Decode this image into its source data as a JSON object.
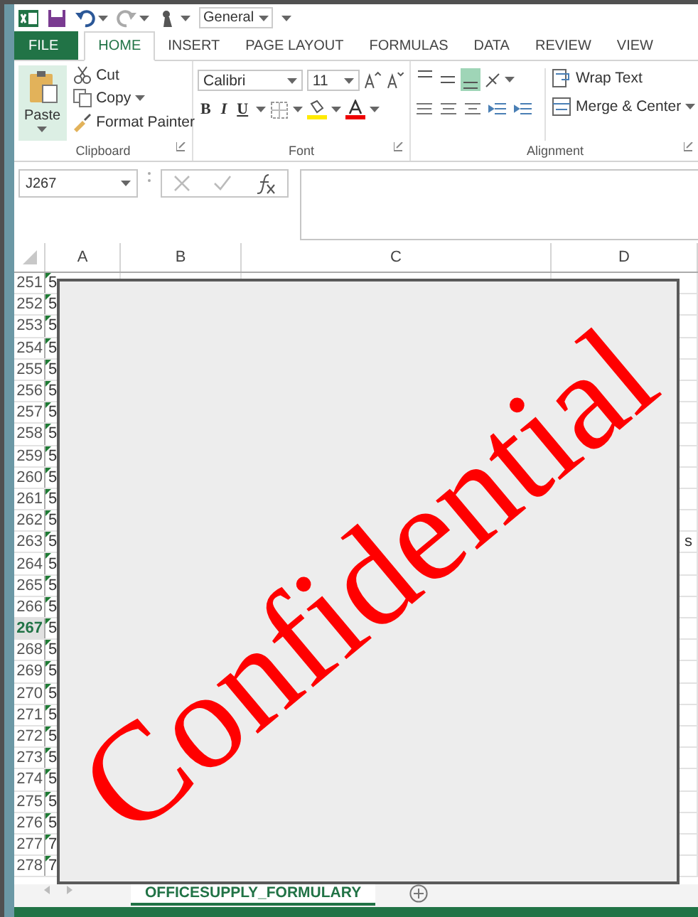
{
  "quick_access": {
    "number_format": "General"
  },
  "tabs": [
    {
      "label": "FILE",
      "kind": "file",
      "selected": false
    },
    {
      "label": "HOME",
      "kind": "tab",
      "selected": true
    },
    {
      "label": "INSERT",
      "kind": "tab",
      "selected": false
    },
    {
      "label": "PAGE LAYOUT",
      "kind": "tab",
      "selected": false
    },
    {
      "label": "FORMULAS",
      "kind": "tab",
      "selected": false
    },
    {
      "label": "DATA",
      "kind": "tab",
      "selected": false
    },
    {
      "label": "REVIEW",
      "kind": "tab",
      "selected": false
    },
    {
      "label": "VIEW",
      "kind": "tab",
      "selected": false
    }
  ],
  "ribbon": {
    "clipboard": {
      "label": "Clipboard",
      "paste": "Paste",
      "cut": "Cut",
      "copy": "Copy",
      "format_painter": "Format Painter"
    },
    "font": {
      "label": "Font",
      "font_name": "Calibri",
      "font_size": "11",
      "bold": "B",
      "italic": "I",
      "underline": "U"
    },
    "alignment": {
      "label": "Alignment",
      "vertical_align": [
        {
          "selected": false
        },
        {
          "selected": false
        },
        {
          "selected": true
        }
      ],
      "wrap_text": "Wrap Text",
      "merge_center": "Merge & Center"
    }
  },
  "formula_bar": {
    "name_box": "J267"
  },
  "columns": [
    "A",
    "B",
    "C",
    "D"
  ],
  "rows": [
    {
      "number": "251",
      "selected": false,
      "cells": [
        "5",
        "",
        ""
      ]
    },
    {
      "number": "252",
      "selected": false,
      "cells": [
        "5",
        "",
        ""
      ]
    },
    {
      "number": "253",
      "selected": false,
      "cells": [
        "5",
        "",
        ""
      ]
    },
    {
      "number": "254",
      "selected": false,
      "cells": [
        "5",
        "",
        ""
      ]
    },
    {
      "number": "255",
      "selected": false,
      "cells": [
        "5",
        "",
        ""
      ]
    },
    {
      "number": "256",
      "selected": false,
      "cells": [
        "5",
        "",
        ""
      ]
    },
    {
      "number": "257",
      "selected": false,
      "cells": [
        "5",
        "",
        ""
      ]
    },
    {
      "number": "258",
      "selected": false,
      "cells": [
        "5",
        "",
        ""
      ]
    },
    {
      "number": "259",
      "selected": false,
      "cells": [
        "5",
        "",
        ""
      ]
    },
    {
      "number": "260",
      "selected": false,
      "cells": [
        "5",
        "",
        ""
      ]
    },
    {
      "number": "261",
      "selected": false,
      "cells": [
        "5",
        "",
        ""
      ]
    },
    {
      "number": "262",
      "selected": false,
      "cells": [
        "5",
        "",
        ""
      ]
    },
    {
      "number": "263",
      "selected": false,
      "cells": [
        "5",
        "",
        "s"
      ]
    },
    {
      "number": "264",
      "selected": false,
      "cells": [
        "5",
        "",
        ""
      ]
    },
    {
      "number": "265",
      "selected": false,
      "cells": [
        "5",
        "",
        ""
      ]
    },
    {
      "number": "266",
      "selected": false,
      "cells": [
        "5",
        "",
        ""
      ]
    },
    {
      "number": "267",
      "selected": true,
      "cells": [
        "5",
        "",
        ""
      ]
    },
    {
      "number": "268",
      "selected": false,
      "cells": [
        "5",
        "",
        ""
      ]
    },
    {
      "number": "269",
      "selected": false,
      "cells": [
        "5",
        "",
        ""
      ]
    },
    {
      "number": "270",
      "selected": false,
      "cells": [
        "5",
        "",
        ""
      ]
    },
    {
      "number": "271",
      "selected": false,
      "cells": [
        "5",
        "",
        ""
      ]
    },
    {
      "number": "272",
      "selected": false,
      "cells": [
        "5",
        "",
        ""
      ]
    },
    {
      "number": "273",
      "selected": false,
      "cells": [
        "5",
        "",
        ""
      ]
    },
    {
      "number": "274",
      "selected": false,
      "cells": [
        "5",
        "",
        ""
      ]
    },
    {
      "number": "275",
      "selected": false,
      "cells": [
        "5",
        "",
        ""
      ]
    },
    {
      "number": "276",
      "selected": false,
      "cells": [
        "5",
        "",
        ""
      ]
    },
    {
      "number": "277",
      "selected": false,
      "cells": [
        "7",
        "",
        ""
      ]
    },
    {
      "number": "278",
      "selected": false,
      "cells": [
        "7",
        "",
        ""
      ]
    }
  ],
  "overlay": {
    "text": "Confidential"
  },
  "sheet_tabs": [
    {
      "label": "OFFICESUPPLY_FORMULARY",
      "selected": true
    }
  ]
}
